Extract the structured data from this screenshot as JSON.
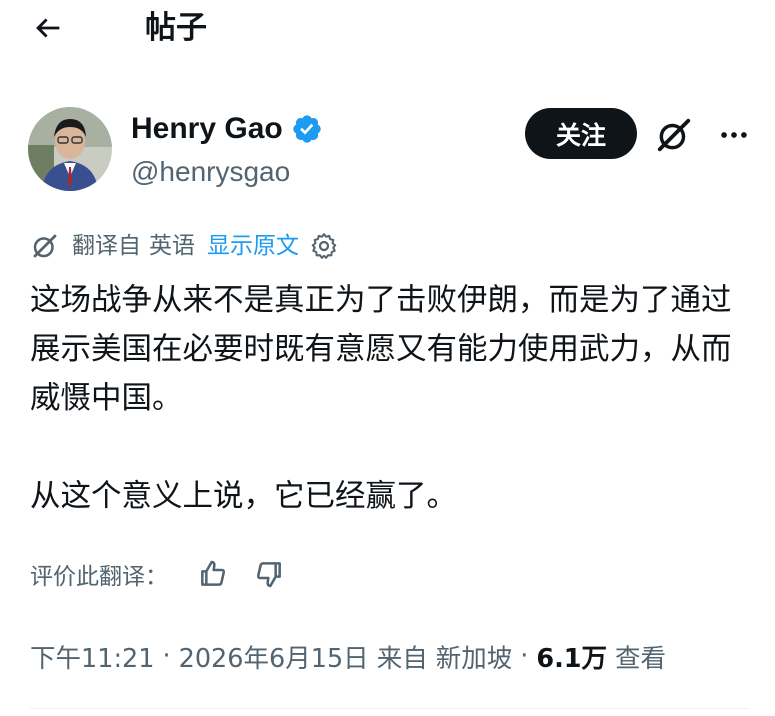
{
  "header": {
    "title": "帖子",
    "back_icon": "arrow-left-icon"
  },
  "author": {
    "display_name": "Henry Gao",
    "handle": "@henrysgao",
    "verified": true,
    "verified_color": "#1d9bf0",
    "follow_label": "关注"
  },
  "translation": {
    "translated_from": "翻译自",
    "language": "英语",
    "show_original": "显示原文",
    "link_color": "#1d9bf0"
  },
  "post": {
    "paragraphs": [
      "这场战争从来不是真正为了击败伊朗，而是为了通过展示美国在必要时既有意愿又有能力使用武力，从而威慑中国。",
      "从这个意义上说，它已经赢了。"
    ]
  },
  "rate": {
    "label": "评价此翻译："
  },
  "meta": {
    "time": "下午11:21",
    "date": "2026年6月15日",
    "from": "来自",
    "location": "新加坡",
    "views_count": "6.1万",
    "views_label": "查看"
  }
}
